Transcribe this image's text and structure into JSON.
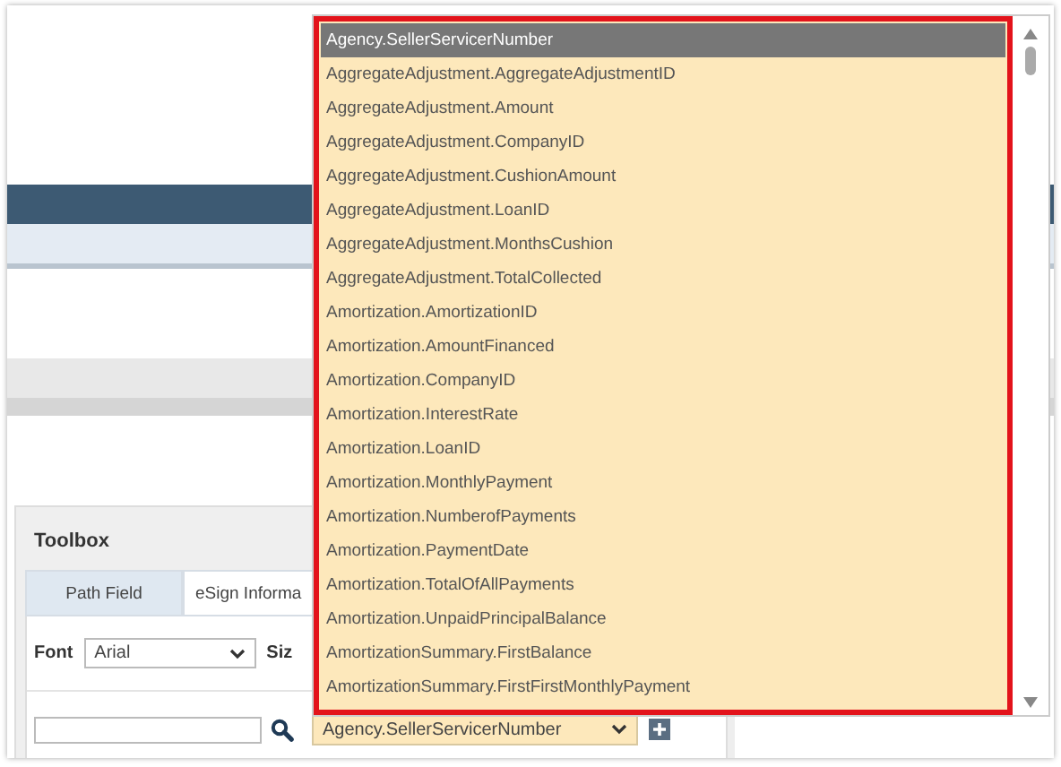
{
  "dropdown_list": {
    "items": [
      {
        "label": "Agency.SellerServicerNumber",
        "selected": true
      },
      {
        "label": "AggregateAdjustment.AggregateAdjustmentID",
        "selected": false
      },
      {
        "label": "AggregateAdjustment.Amount",
        "selected": false
      },
      {
        "label": "AggregateAdjustment.CompanyID",
        "selected": false
      },
      {
        "label": "AggregateAdjustment.CushionAmount",
        "selected": false
      },
      {
        "label": "AggregateAdjustment.LoanID",
        "selected": false
      },
      {
        "label": "AggregateAdjustment.MonthsCushion",
        "selected": false
      },
      {
        "label": "AggregateAdjustment.TotalCollected",
        "selected": false
      },
      {
        "label": "Amortization.AmortizationID",
        "selected": false
      },
      {
        "label": "Amortization.AmountFinanced",
        "selected": false
      },
      {
        "label": "Amortization.CompanyID",
        "selected": false
      },
      {
        "label": "Amortization.InterestRate",
        "selected": false
      },
      {
        "label": "Amortization.LoanID",
        "selected": false
      },
      {
        "label": "Amortization.MonthlyPayment",
        "selected": false
      },
      {
        "label": "Amortization.NumberofPayments",
        "selected": false
      },
      {
        "label": "Amortization.PaymentDate",
        "selected": false
      },
      {
        "label": "Amortization.TotalOfAllPayments",
        "selected": false
      },
      {
        "label": "Amortization.UnpaidPrincipalBalance",
        "selected": false
      },
      {
        "label": "AmortizationSummary.FirstBalance",
        "selected": false
      },
      {
        "label": "AmortizationSummary.FirstFirstMonthlyPayment",
        "selected": false
      }
    ]
  },
  "toolbox": {
    "title": "Toolbox",
    "tabs": [
      {
        "label": "Path Field",
        "selected": true
      },
      {
        "label": "eSign Informa",
        "selected": false
      }
    ],
    "font_label": "Font",
    "font_select": "Arial",
    "size_label": "Siz",
    "path_select": "Agency.SellerServicerNumber"
  }
}
